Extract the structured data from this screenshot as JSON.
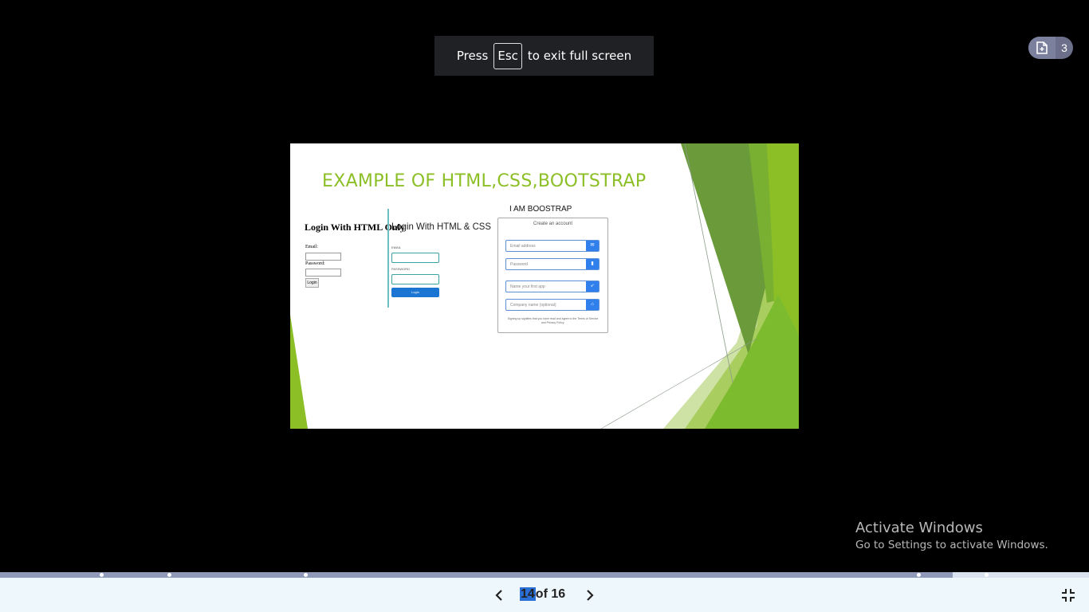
{
  "fullscreen_toast": {
    "press": "Press",
    "key": "Esc",
    "suffix": "to exit full screen"
  },
  "badge": {
    "icon": "document-icon",
    "count": "3"
  },
  "slide": {
    "title": "EXAMPLE OF HTML,CSS,BOOTSTRAP",
    "panel_html": {
      "title": "Login With HTML Only",
      "email_label": "Email:",
      "password_label": "Password:",
      "button": "Login"
    },
    "panel_css": {
      "title": "Login With HTML & CSS",
      "email_label": "EMAIL",
      "password_label": "PASSWORD",
      "button": "Login"
    },
    "panel_bootstrap": {
      "heading": "I AM BOOSTRAP",
      "card_title": "Create an account",
      "email_placeholder": "Email address",
      "password_placeholder": "Password",
      "app_placeholder": "Name your first app",
      "company_placeholder": "Company name (optional)",
      "terms": "Signing up signifies that you have read and agree to the Terms of Service and Privacy Policy."
    },
    "accent_color": "#8cbf26"
  },
  "watermark": {
    "line1": "Activate Windows",
    "line2": "Go to Settings to activate Windows."
  },
  "progress": {
    "fraction": 0.875
  },
  "pagination": {
    "current": "14",
    "total_text": "of 16"
  },
  "icons": {
    "prev": "chevron-left-icon",
    "next": "chevron-right-icon",
    "exit": "exit-fullscreen-icon"
  }
}
